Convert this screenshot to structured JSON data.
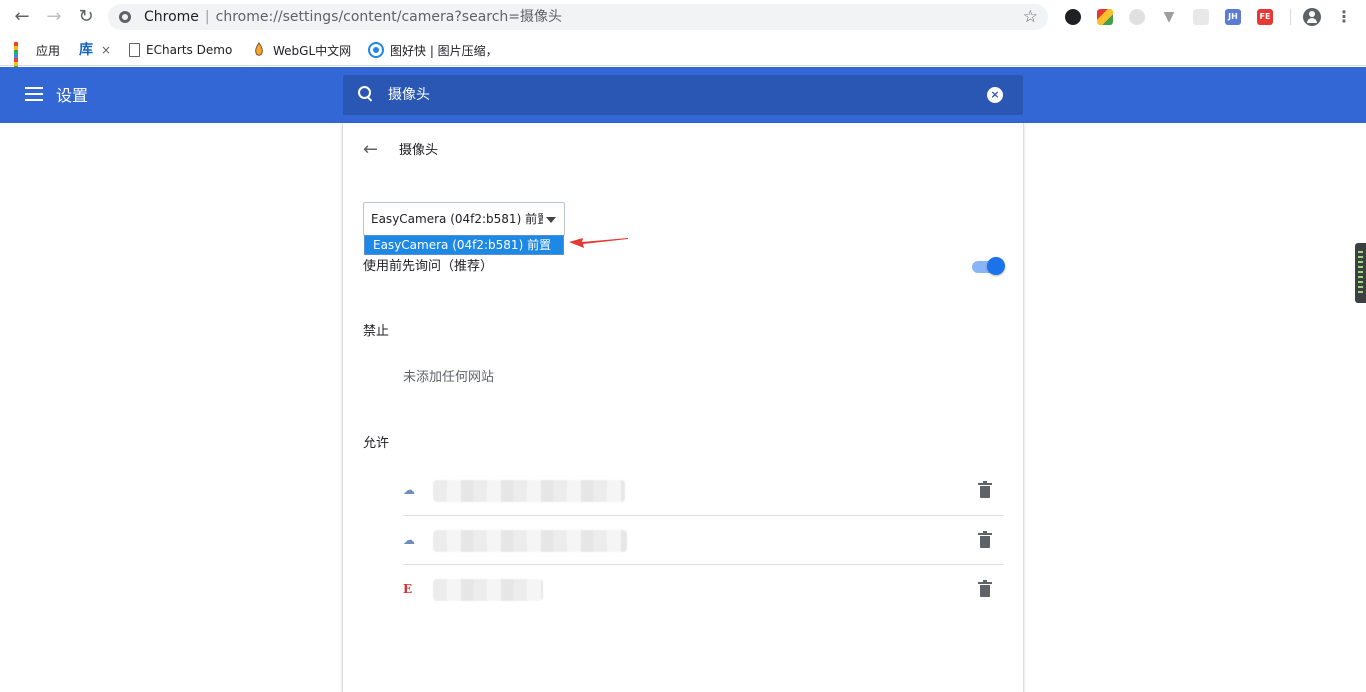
{
  "browser": {
    "omnibox": {
      "site_label": "Chrome",
      "separator": "|",
      "url": "chrome://settings/content/camera?search=摄像头"
    },
    "extensions": [
      {
        "name": "ext-1",
        "color": "#202124"
      },
      {
        "name": "ext-2",
        "color": "#4caf50"
      },
      {
        "name": "ext-3",
        "color": "#cfcfcf"
      },
      {
        "name": "ext-4",
        "color": "#9e9e9e"
      },
      {
        "name": "ext-5",
        "color": "#d0d0d0"
      },
      {
        "name": "ext-jh",
        "label": "JH",
        "color": "#5b7bd5"
      },
      {
        "name": "ext-fe",
        "label": "FE",
        "color": "#e53935"
      }
    ],
    "bookmarks": [
      {
        "label": "应用",
        "icon": "apps-icon"
      },
      {
        "label": "×",
        "icon": "ku-icon",
        "icon_text": "库"
      },
      {
        "label": "ECharts Demo",
        "icon": "page-icon"
      },
      {
        "label": "WebGL中文网",
        "icon": "webgl-icon"
      },
      {
        "label": "图好快 | 图片压缩，",
        "icon": "tuhaokuai-icon"
      }
    ]
  },
  "settings": {
    "header_title": "设置",
    "search": {
      "value": "摄像头",
      "clear_icon": "×"
    },
    "subpage": {
      "back_icon": "←",
      "title": "摄像头",
      "camera_select": {
        "selected": "EasyCamera (04f2:b581) 前置",
        "options": [
          "EasyCamera (04f2:b581) 前置"
        ]
      },
      "ask_before_access": {
        "label": "使用前先询问（推荐）",
        "enabled": true
      },
      "blocked": {
        "label": "禁止",
        "empty_text": "未添加任何网站"
      },
      "allowed": {
        "label": "允许",
        "sites": [
          {
            "icon": "cloud-icon",
            "icon_color": "#6c8ebf",
            "name": "████████████████"
          },
          {
            "icon": "cloud-icon",
            "icon_color": "#6c8ebf",
            "name": "████████████████"
          },
          {
            "icon": "e-logo-icon",
            "icon_color": "#d32f2f",
            "name": "█████████"
          }
        ]
      }
    }
  },
  "colors": {
    "header": "#3367d6",
    "search_box": "#2a56b4",
    "toggle_on": "#1a73e8",
    "annotation_arrow": "#e53935"
  }
}
